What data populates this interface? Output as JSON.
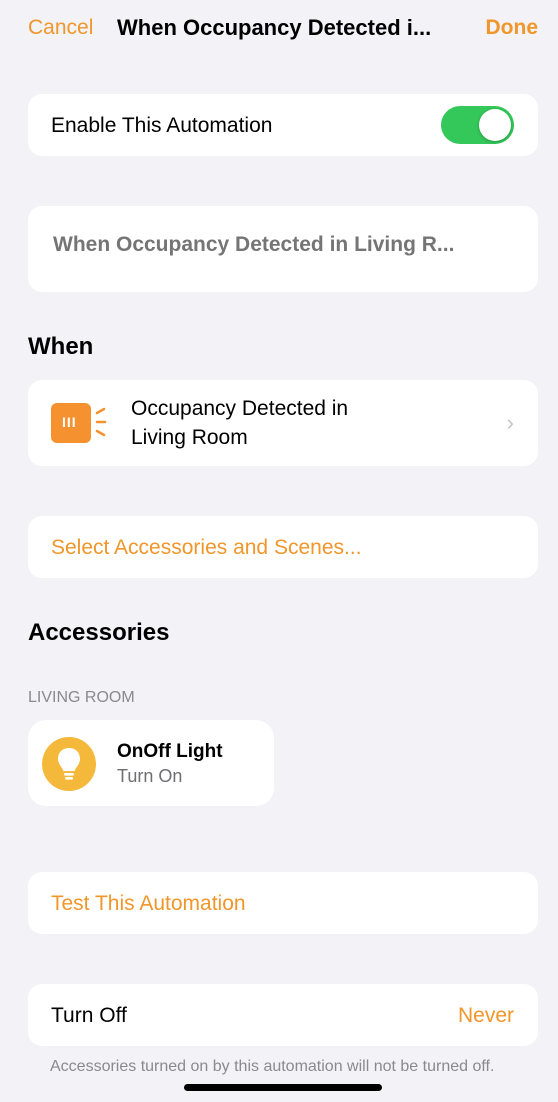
{
  "nav": {
    "cancel_label": "Cancel",
    "title": "When Occupancy Detected i...",
    "done_label": "Done"
  },
  "enable": {
    "label": "Enable This Automation",
    "on": true
  },
  "name_field": {
    "placeholder": "When Occupancy Detected in Living R..."
  },
  "when": {
    "heading": "When",
    "trigger_line1": "Occupancy Detected in",
    "trigger_line2": "Living Room",
    "icon": "occupancy-sensor-icon"
  },
  "select_accessories_label": "Select Accessories and Scenes...",
  "accessories": {
    "heading": "Accessories",
    "room": "LIVING ROOM",
    "items": [
      {
        "name": "OnOff Light",
        "state": "Turn On",
        "icon": "lightbulb-icon"
      }
    ]
  },
  "test_label": "Test This Automation",
  "turn_off": {
    "label": "Turn Off",
    "value": "Never",
    "footnote": "Accessories turned on by this automation will not be turned off."
  },
  "colors": {
    "accent": "#f0962a",
    "toggle_on": "#34c759",
    "sensor": "#f5912f",
    "bulb": "#f4b93a",
    "background": "#f2f2f7"
  }
}
